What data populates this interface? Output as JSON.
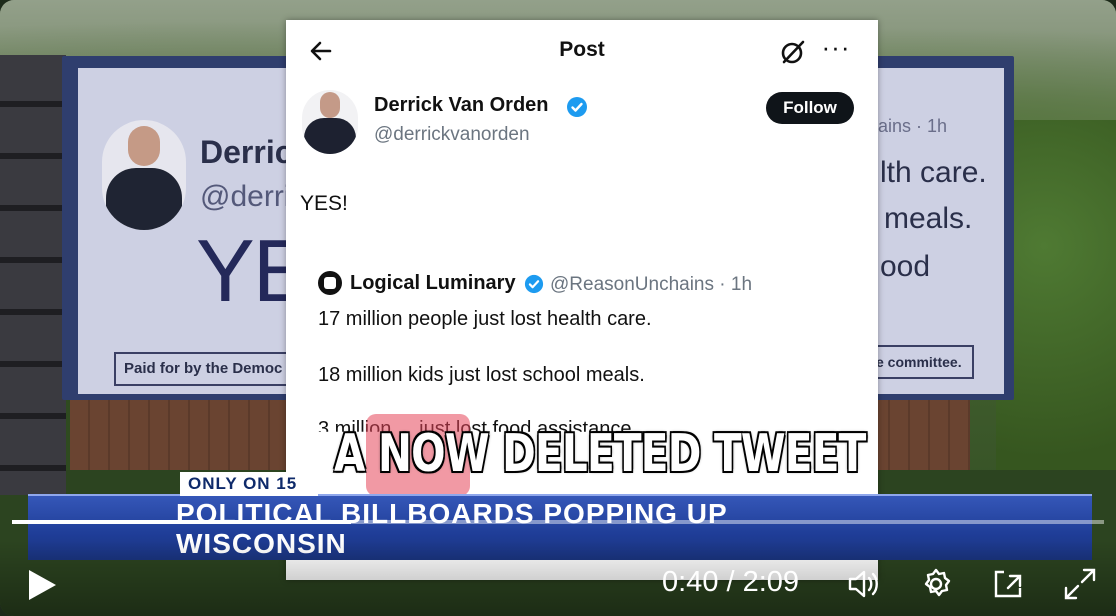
{
  "billboard": {
    "name_partial": "Derric",
    "handle_partial": "@derri",
    "big_text": "YE",
    "paid_partial": "Paid for by the Democ",
    "right_handle_partial": "ains · 1h",
    "right_line1": "lth care.",
    "right_line2": "meals.",
    "right_line3": "ood",
    "right_paid_partial": "e committee."
  },
  "tweet": {
    "header_title": "Post",
    "back_icon": "back-arrow-icon",
    "grok_icon": "grok-icon",
    "more_icon": "more-icon",
    "more_label": "···",
    "author_name": "Derrick Van Orden",
    "author_handle": "@derrickvanorden",
    "follow_label": "Follow",
    "text": "YES!",
    "quote": {
      "author_name": "Logical Luminary",
      "author_handle_time": "@ReasonUnchains · 1h",
      "line1": "17 million people just lost health care.",
      "line2": "18 million kids just lost school meals.",
      "line3": "3 million ... just lost food assistance."
    }
  },
  "overlay": {
    "caption": "A NOW DELETED TWEET"
  },
  "lower_third": {
    "badge": "ONLY ON 15",
    "line1": "POLITICAL BILLBOARDS POPPING UP",
    "line2": "WISCONSIN"
  },
  "player": {
    "current_time": "0:40",
    "duration": "2:09",
    "time_display": "0:40 / 2:09",
    "progress_fraction": 0.31,
    "icons": [
      "play-icon",
      "volume-icon",
      "settings-icon",
      "pip-icon",
      "fullscreen-icon"
    ]
  },
  "colors": {
    "x_verified_blue": "#1d9bf0",
    "lower_third_blue": "#1f3d97",
    "caption_highlight": "#e6465a"
  }
}
